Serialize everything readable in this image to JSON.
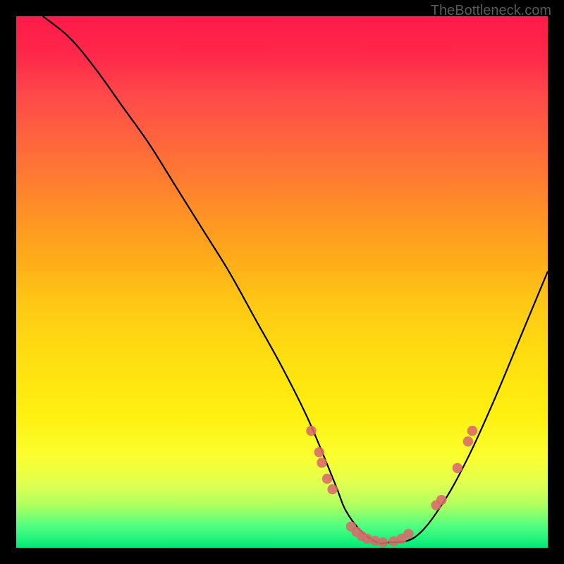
{
  "watermark": "TheBottleneck.com",
  "chart_data": {
    "type": "line",
    "title": "",
    "xlabel": "",
    "ylabel": "",
    "xlim": [
      0,
      100
    ],
    "ylim": [
      0,
      100
    ],
    "curve": {
      "name": "bottleneck-curve",
      "x": [
        5,
        10,
        15,
        20,
        25,
        30,
        35,
        40,
        45,
        50,
        55,
        60,
        62,
        65,
        68,
        70,
        75,
        80,
        85,
        90,
        95,
        100
      ],
      "y": [
        100,
        96,
        90,
        83,
        76,
        68,
        60,
        52,
        43,
        34,
        24,
        12,
        7,
        3,
        1,
        1,
        2,
        8,
        17,
        28,
        40,
        52
      ]
    },
    "dots": {
      "name": "highlight-points",
      "color": "#d86a6a",
      "points": [
        {
          "x": 55.5,
          "y": 22
        },
        {
          "x": 57,
          "y": 18
        },
        {
          "x": 57.5,
          "y": 16
        },
        {
          "x": 58.5,
          "y": 13
        },
        {
          "x": 59.5,
          "y": 11
        },
        {
          "x": 63,
          "y": 4
        },
        {
          "x": 64,
          "y": 3
        },
        {
          "x": 65,
          "y": 2.2
        },
        {
          "x": 66,
          "y": 1.7
        },
        {
          "x": 67.5,
          "y": 1.3
        },
        {
          "x": 69,
          "y": 1
        },
        {
          "x": 71,
          "y": 1.2
        },
        {
          "x": 72.5,
          "y": 1.7
        },
        {
          "x": 73.8,
          "y": 2.6
        },
        {
          "x": 79,
          "y": 8
        },
        {
          "x": 80,
          "y": 9
        },
        {
          "x": 83,
          "y": 15
        },
        {
          "x": 85,
          "y": 20
        },
        {
          "x": 85.8,
          "y": 22
        }
      ]
    },
    "gradient_stops": [
      {
        "pos": 0,
        "color": "#ff1a4a"
      },
      {
        "pos": 50,
        "color": "#ffcc15"
      },
      {
        "pos": 85,
        "color": "#f5ff30"
      },
      {
        "pos": 100,
        "color": "#00e878"
      }
    ]
  }
}
